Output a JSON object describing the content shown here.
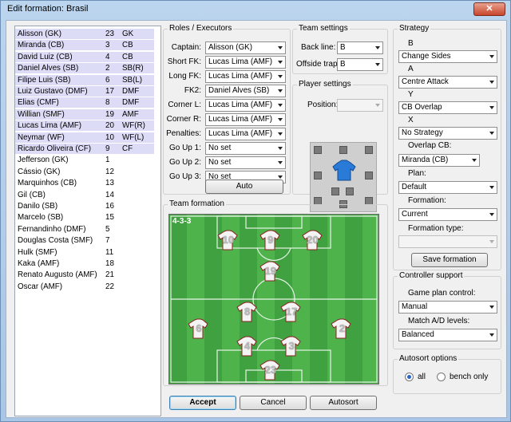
{
  "window": {
    "title": "Edit formation: Brasil",
    "close": "✕"
  },
  "players": [
    {
      "name": "Alisson (GK)",
      "number": "23",
      "pos": "GK",
      "sel": true
    },
    {
      "name": "Miranda (CB)",
      "number": "3",
      "pos": "CB",
      "sel": true
    },
    {
      "name": "David Luiz (CB)",
      "number": "4",
      "pos": "CB",
      "sel": true
    },
    {
      "name": "Daniel Alves (SB)",
      "number": "2",
      "pos": "SB(R)",
      "sel": true
    },
    {
      "name": "Filipe Luis (SB)",
      "number": "6",
      "pos": "SB(L)",
      "sel": true
    },
    {
      "name": "Luiz Gustavo (DMF)",
      "number": "17",
      "pos": "DMF",
      "sel": true
    },
    {
      "name": "Elias (CMF)",
      "number": "8",
      "pos": "DMF",
      "sel": true
    },
    {
      "name": "Willian (SMF)",
      "number": "19",
      "pos": "AMF",
      "sel": true
    },
    {
      "name": "Lucas Lima (AMF)",
      "number": "20",
      "pos": "WF(R)",
      "sel": true
    },
    {
      "name": "Neymar (WF)",
      "number": "10",
      "pos": "WF(L)",
      "sel": true
    },
    {
      "name": "Ricardo Oliveira (CF)",
      "number": "9",
      "pos": "CF",
      "sel": true
    },
    {
      "name": "Jefferson (GK)",
      "number": "1",
      "pos": "",
      "sel": false
    },
    {
      "name": "Cássio (GK)",
      "number": "12",
      "pos": "",
      "sel": false
    },
    {
      "name": "Marquinhos (CB)",
      "number": "13",
      "pos": "",
      "sel": false
    },
    {
      "name": "Gil (CB)",
      "number": "14",
      "pos": "",
      "sel": false
    },
    {
      "name": "Danilo (SB)",
      "number": "16",
      "pos": "",
      "sel": false
    },
    {
      "name": "Marcelo (SB)",
      "number": "15",
      "pos": "",
      "sel": false
    },
    {
      "name": "Fernandinho (DMF)",
      "number": "5",
      "pos": "",
      "sel": false
    },
    {
      "name": "Douglas Costa (SMF)",
      "number": "7",
      "pos": "",
      "sel": false
    },
    {
      "name": "Hulk (SMF)",
      "number": "11",
      "pos": "",
      "sel": false
    },
    {
      "name": "Kaka (AMF)",
      "number": "18",
      "pos": "",
      "sel": false
    },
    {
      "name": "Renato Augusto (AMF)",
      "number": "21",
      "pos": "",
      "sel": false
    },
    {
      "name": "Oscar (AMF)",
      "number": "22",
      "pos": "",
      "sel": false
    }
  ],
  "roles": {
    "title": "Roles / Executors",
    "rows": [
      {
        "label": "Captain:",
        "value": "Alisson (GK)"
      },
      {
        "label": "Short FK:",
        "value": "Lucas Lima (AMF)"
      },
      {
        "label": "Long FK:",
        "value": "Lucas Lima (AMF)"
      },
      {
        "label": "FK2:",
        "value": "Daniel Alves (SB)"
      },
      {
        "label": "Corner L:",
        "value": "Lucas Lima (AMF)"
      },
      {
        "label": "Corner R:",
        "value": "Lucas Lima (AMF)"
      },
      {
        "label": "Penalties:",
        "value": "Lucas Lima (AMF)"
      },
      {
        "label": "Go Up 1:",
        "value": "No set"
      },
      {
        "label": "Go Up 2:",
        "value": "No set"
      },
      {
        "label": "Go Up 3:",
        "value": "No set"
      }
    ],
    "auto": "Auto"
  },
  "team_settings": {
    "title": "Team settings",
    "back_line_label": "Back line:",
    "back_line": "B",
    "offside_label": "Offside trap:",
    "offside": "B"
  },
  "player_settings": {
    "title": "Player settings",
    "position_label": "Position:",
    "position": ""
  },
  "strategy": {
    "title": "Strategy",
    "keys": [
      {
        "key": "B",
        "value": "Change Sides"
      },
      {
        "key": "A",
        "value": "Centre Attack"
      },
      {
        "key": "Y",
        "value": "CB Overlap"
      },
      {
        "key": "X",
        "value": "No Strategy"
      }
    ],
    "overlap_label": "Overlap CB:",
    "overlap": "Miranda (CB)",
    "plan_label": "Plan:",
    "plan": "Default",
    "formation_label": "Formation:",
    "formation": "Current",
    "formation_type_label": "Formation type:",
    "formation_type": "",
    "save": "Save formation"
  },
  "controller": {
    "title": "Controller support",
    "game_plan_label": "Game plan control:",
    "game_plan": "Manual",
    "match_label": "Match A/D levels:",
    "match": "Balanced"
  },
  "autosort": {
    "title": "Autosort options",
    "all": "all",
    "bench": "bench only",
    "selected": "all"
  },
  "team_formation": {
    "title": "Team formation",
    "label": "4-3-3"
  },
  "formation_players": [
    {
      "num": "10",
      "col": 0.28,
      "row": 0.15
    },
    {
      "num": "9",
      "col": 0.48,
      "row": 0.15
    },
    {
      "num": "20",
      "col": 0.68,
      "row": 0.15
    },
    {
      "num": "19",
      "col": 0.48,
      "row": 0.33
    },
    {
      "num": "8",
      "col": 0.37,
      "row": 0.57
    },
    {
      "num": "17",
      "col": 0.58,
      "row": 0.57
    },
    {
      "num": "6",
      "col": 0.14,
      "row": 0.67
    },
    {
      "num": "2",
      "col": 0.82,
      "row": 0.67
    },
    {
      "num": "4",
      "col": 0.37,
      "row": 0.77
    },
    {
      "num": "3",
      "col": 0.58,
      "row": 0.77
    },
    {
      "num": "23",
      "col": 0.48,
      "row": 0.91
    }
  ],
  "buttons": {
    "accept": "Accept",
    "cancel": "Cancel",
    "autosort": "Autosort"
  }
}
